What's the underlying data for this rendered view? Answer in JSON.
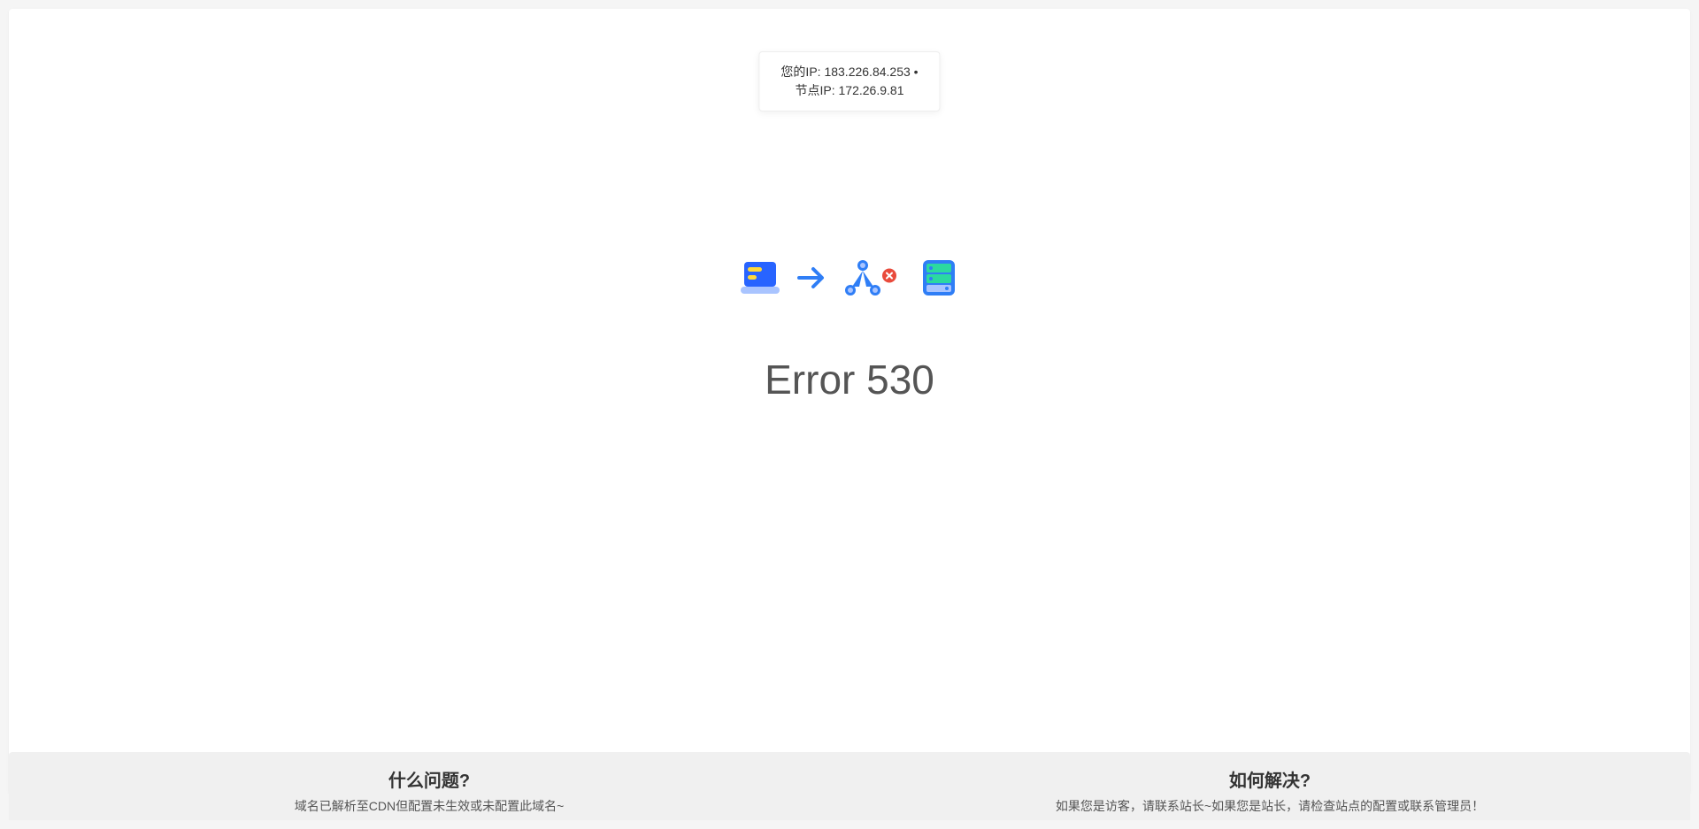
{
  "ip_info": {
    "your_ip_label": "您的IP:",
    "your_ip_value": "183.226.84.253",
    "separator": "•",
    "node_ip_label": "节点IP:",
    "node_ip_value": "172.26.9.81"
  },
  "error": {
    "title": "Error 530"
  },
  "footer": {
    "problem": {
      "title": "什么问题?",
      "desc": "域名已解析至CDN但配置未生效或未配置此域名~"
    },
    "solution": {
      "title": "如何解决?",
      "desc": "如果您是访客，请联系站长~如果您是站长，请检查站点的配置或联系管理员！"
    }
  }
}
